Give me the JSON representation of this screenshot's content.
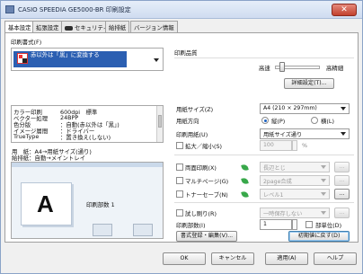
{
  "window": {
    "title": "CASIO SPEEDIA GE5000-BR 印刷設定",
    "close_symbol": "✕"
  },
  "tabs": [
    "基本設定",
    "拡張設定",
    "セキュリティ",
    "給排紙",
    "バージョン情報"
  ],
  "left": {
    "print_style_label": "印刷書式(F)",
    "print_style_text": "赤以外は「黒」に変換する",
    "info_rows": [
      {
        "k": "カラー印刷",
        "v": "600dpi　標準"
      },
      {
        "k": "ベクター処理",
        "v": "24BPP"
      },
      {
        "k": "色分版",
        "v": "：自動(赤以外は「黒」)"
      },
      {
        "k": "イメージ層間",
        "v": "：ドライバー"
      },
      {
        "k": "TrueType",
        "v": "：置き換え(しない)"
      }
    ],
    "paper_summary_1": "用　紙：A4→用紙サイズ(通り)",
    "paper_summary_2": "給排紙：自動→メイントレイ",
    "preview_letter": "A",
    "preview_copies": "印刷部数 1"
  },
  "right": {
    "quality_label": "印刷品質",
    "speed_label": "高速",
    "fine_label": "高精細",
    "slider_level": 0.15,
    "detail_button": "詳細設定(T)...",
    "paper_size_label": "用紙サイズ(Z)",
    "paper_size_value": "A4 (210 × 297mm)",
    "orientation_label": "用紙方向",
    "portrait_label": "縦(P)",
    "landscape_label": "横(L)",
    "output_size_label": "印刷用紙(U)",
    "output_size_value": "用紙サイズ通り",
    "scale_label": "拡大／縮小(S)",
    "scale_value": "100",
    "scale_unit": "%",
    "duplex_label": "両面印刷(X)",
    "duplex_value": "長辺とじ",
    "multipage_label": "マルチページ(G)",
    "multipage_value": "2page合成",
    "toner_label": "トナーセーブ(N)",
    "toner_value": "レベル1",
    "trial_label": "試し刷り(R)",
    "trial_value": "一時保存しない",
    "copies_label": "印刷部数(I)",
    "copies_value": "1",
    "collate_label": "部単位(D)",
    "register_button": "書式登録・編集(V)...",
    "reset_button": "初期値に戻す(D)",
    "more_symbol": "..."
  },
  "buttons": {
    "ok": "OK",
    "cancel": "キャンセル",
    "apply": "適用(A)",
    "help": "ヘルプ"
  },
  "colors": {
    "accent": "#3c7fb1",
    "title_bg": "#dbe6f5",
    "close_red": "#c2412e"
  }
}
